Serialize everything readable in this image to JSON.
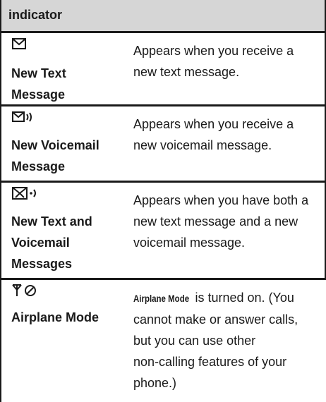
{
  "header": {
    "title": "indicator"
  },
  "rows": [
    {
      "icon": "message-icon",
      "name": "New Text Message",
      "name_lines": [
        "New Text",
        "Message"
      ],
      "description": "Appears when you receive a new text message.",
      "desc_lines": [
        "Appears when you receive a",
        "new text message."
      ]
    },
    {
      "icon": "voicemail-icon",
      "name": "New Voicemail Message",
      "name_lines": [
        "New Voicemail",
        "Message"
      ],
      "description": "Appears when you receive a new voicemail message.",
      "desc_lines": [
        "Appears when you receive a",
        "new voicemail message."
      ]
    },
    {
      "icon": "text-voicemail-icon",
      "name": "New Text and Voicemail Messages",
      "name_lines": [
        "New Text and",
        "Voicemail",
        "Messages"
      ],
      "description": "Appears when you have both a new text message and a new voicemail message.",
      "desc_lines": [
        "Appears when you have both a",
        "new text message and a new",
        "voicemail message."
      ]
    },
    {
      "icon": "airplane-mode-icon",
      "name": "Airplane Mode",
      "name_lines": [
        "Airplane Mode"
      ],
      "description_term": "Airplane Mode",
      "desc_lines": [
        " is turned on. (You",
        "cannot make or answer calls,",
        "but you can use other",
        "non-calling features of your",
        "phone.)"
      ]
    }
  ]
}
